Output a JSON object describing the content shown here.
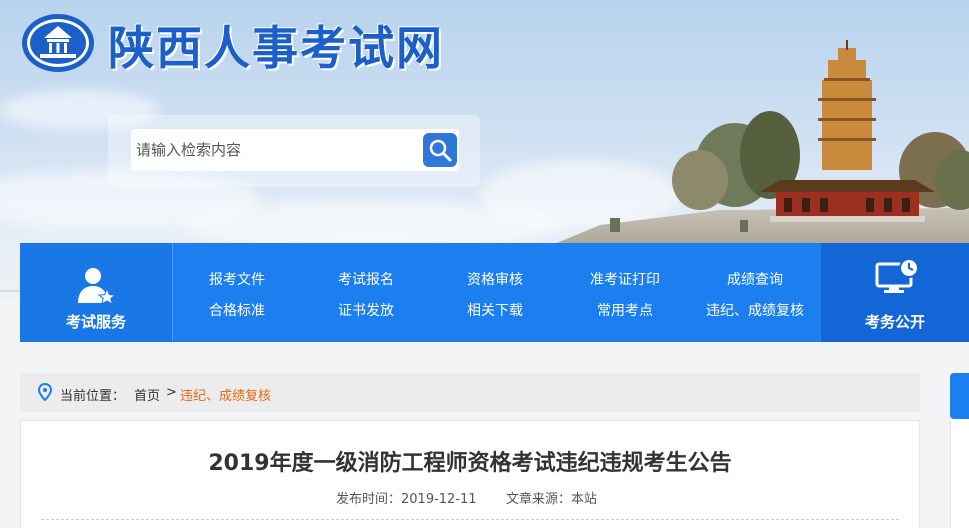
{
  "header": {
    "site_title": "陕西人事考试网",
    "logo_icon": "emblem-logo-icon"
  },
  "search": {
    "placeholder": "请输入检索内容",
    "button_icon": "search-icon"
  },
  "nav": {
    "left_block": {
      "label": "考试服务",
      "icon": "user-star-icon"
    },
    "right_block": {
      "label": "考务公开",
      "icon": "monitor-clock-icon"
    },
    "links_row1": [
      "报考文件",
      "考试报名",
      "资格审核",
      "准考证打印",
      "成绩查询"
    ],
    "links_row2": [
      "合格标准",
      "证书发放",
      "相关下载",
      "常用考点",
      "违纪、成绩复核"
    ]
  },
  "breadcrumb": {
    "icon": "location-pin-icon",
    "label": "当前位置：",
    "home": "首页",
    "separator": ">",
    "current": "违纪、成绩复核"
  },
  "article": {
    "title": "2019年度一级消防工程师资格考试违纪违规考生公告",
    "publish_time": "发布时间：2019-12-11",
    "source": "文章来源：本站"
  },
  "colors": {
    "nav_blue": "#1b7ff0",
    "title_blue": "#1d5fc9",
    "breadcrumb_current": "#e26a1a"
  }
}
